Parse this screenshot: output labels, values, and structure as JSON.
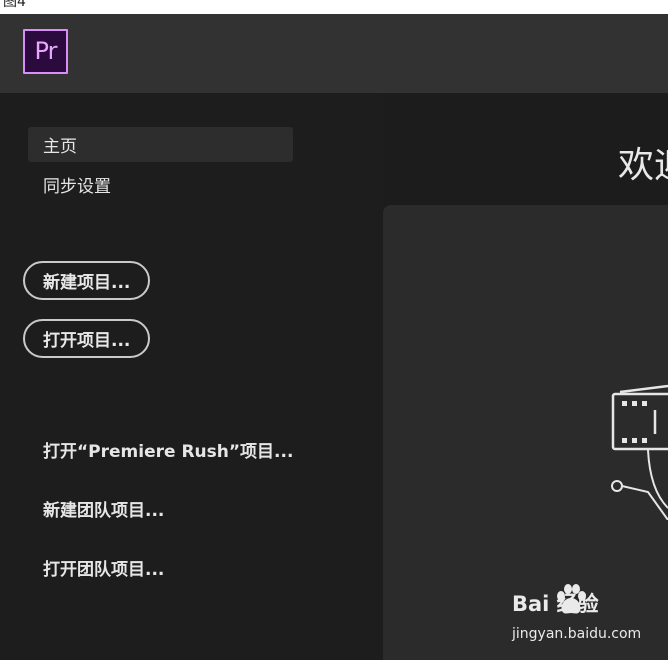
{
  "top_strip": {
    "fragment": "图4"
  },
  "app": {
    "logo_text": "Pr",
    "logo_colors": {
      "background": "#2b0a3d",
      "border": "#d98ef7",
      "text": "#e9a6ff"
    }
  },
  "sidebar": {
    "nav": [
      {
        "label": "主页",
        "active": true
      },
      {
        "label": "同步设置",
        "active": false
      }
    ],
    "buttons": {
      "new_project": "新建项目...",
      "open_project": "打开项目..."
    },
    "links": {
      "open_rush": "打开“Premiere Rush”项目...",
      "new_team": "新建团队项目...",
      "open_team": "打开团队项目..."
    }
  },
  "main": {
    "welcome_title": "欢迎"
  },
  "watermark": {
    "brand": "Bai  经验",
    "url": "jingyan.baidu.com"
  }
}
